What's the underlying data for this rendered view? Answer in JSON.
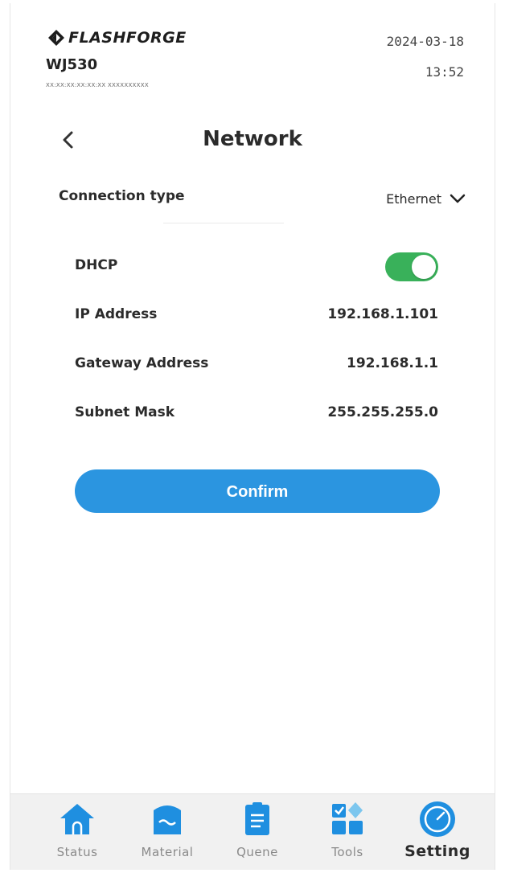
{
  "header": {
    "brand": "FLASHFORGE",
    "device_name": "WJ530",
    "device_id": "XX:XX:XX:XX:XX:XX   XXXXXXXXXX",
    "date": "2024-03-18",
    "time": "13:52"
  },
  "page": {
    "title": "Network"
  },
  "connection": {
    "label": "Connection type",
    "value": "Ethernet"
  },
  "settings": {
    "dhcp": {
      "label": "DHCP",
      "enabled": true
    },
    "ip": {
      "label": "IP Address",
      "value": "192.168.1.101"
    },
    "gateway": {
      "label": "Gateway Address",
      "value": "192.168.1.1"
    },
    "subnet": {
      "label": "Subnet Mask",
      "value": "255.255.255.0"
    }
  },
  "actions": {
    "confirm_label": "Confirm"
  },
  "nav": {
    "items": [
      {
        "label": "Status",
        "icon": "home-icon",
        "active": false
      },
      {
        "label": "Material",
        "icon": "material-icon",
        "active": false
      },
      {
        "label": "Quene",
        "icon": "queue-icon",
        "active": false
      },
      {
        "label": "Tools",
        "icon": "tools-icon",
        "active": false
      },
      {
        "label": "Setting",
        "icon": "setting-icon",
        "active": true
      }
    ]
  },
  "colors": {
    "accent": "#2b95e0",
    "toggle_on": "#39b15a",
    "nav_icon": "#1f8fe0"
  }
}
